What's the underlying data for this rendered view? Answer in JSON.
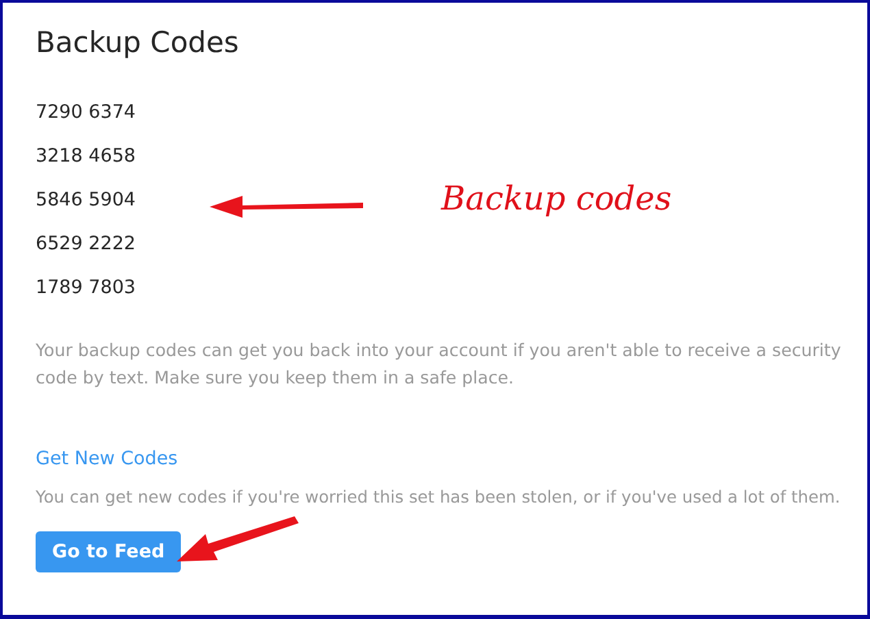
{
  "title": "Backup Codes",
  "codes": [
    "7290 6374",
    "3218 4658",
    "5846 5904",
    "6529 2222",
    "1789 7803"
  ],
  "description": "Your backup codes can get you back into your account if you aren't able to receive a security code by text. Make sure you keep them in a safe place.",
  "new_codes": {
    "link": "Get New Codes",
    "description": "You can get new codes if you're worried this set has been stolen, or if you've used a lot of them."
  },
  "button": "Go to Feed",
  "annotation": {
    "label": "Backup codes"
  }
}
